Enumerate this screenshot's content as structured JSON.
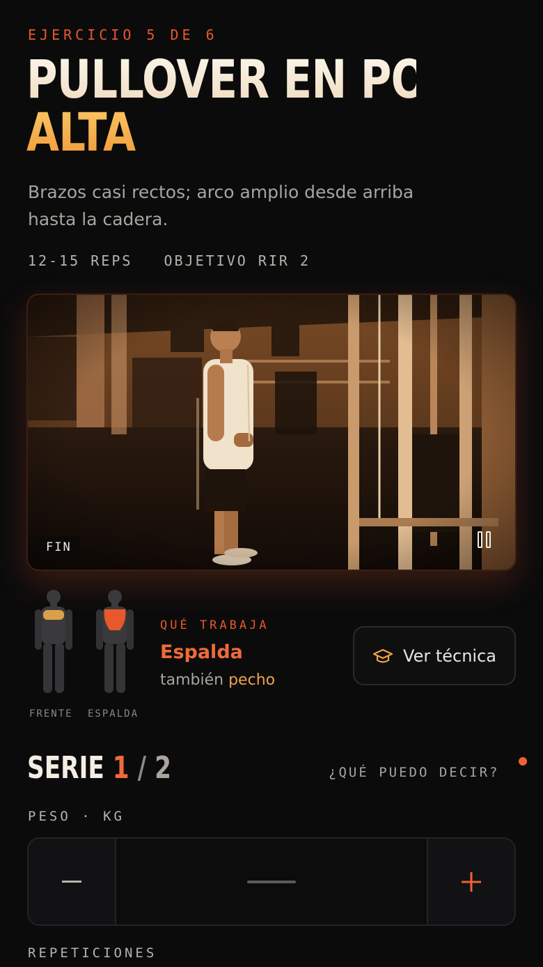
{
  "header": {
    "eyebrow": "EJERCICIO 5 DE 6",
    "title_line1": "PULLOVER EN POLEA",
    "title_line2": "ALTA",
    "description": "Brazos casi rectos; arco amplio desde arriba hasta la cadera.",
    "reps": "12-15 REPS",
    "target": "OBJETIVO RIR 2"
  },
  "video": {
    "badge": "FIN",
    "control_icon": "pause-icon"
  },
  "muscles": {
    "front_label": "FRENTE",
    "back_label": "ESPALDA",
    "eyebrow": "QUÉ TRABAJA",
    "primary": "Espalda",
    "secondary_prefix": "también",
    "secondary": "pecho"
  },
  "technique_button": {
    "icon": "graduation-cap-icon",
    "label": "Ver técnica"
  },
  "set": {
    "label": "SERIE",
    "current": "1",
    "separator": "/",
    "total": "2",
    "help_link": "¿QUÉ PUEDO DECIR?"
  },
  "weight": {
    "label": "PESO · KG",
    "minus_icon": "minus-icon",
    "plus_icon": "plus-icon"
  },
  "reps_field": {
    "label": "REPETICIONES"
  },
  "colors": {
    "accent": "#e8582c",
    "accent_warm": "#f0a24a",
    "background": "#0b0b0c"
  }
}
